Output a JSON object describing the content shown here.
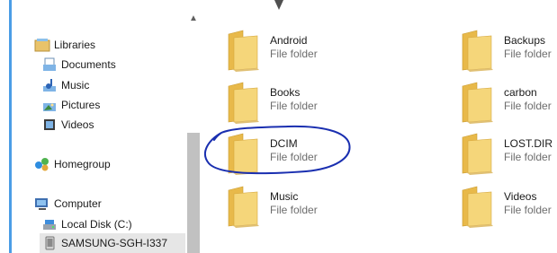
{
  "navigation": {
    "items": [
      {
        "label": "Libraries",
        "icon": "libraries-icon"
      },
      {
        "label": "Documents",
        "icon": "documents-icon"
      },
      {
        "label": "Music",
        "icon": "music-icon"
      },
      {
        "label": "Pictures",
        "icon": "pictures-icon"
      },
      {
        "label": "Videos",
        "icon": "videos-icon"
      },
      {
        "label": "Homegroup",
        "icon": "homegroup-icon"
      },
      {
        "label": "Computer",
        "icon": "computer-icon"
      },
      {
        "label": "Local Disk (C:)",
        "icon": "local-disk-icon"
      },
      {
        "label": "SAMSUNG-SGH-I337",
        "icon": "phone-icon",
        "selected": true
      }
    ]
  },
  "folders": [
    {
      "name": "Android",
      "type": "File folder"
    },
    {
      "name": "Backups",
      "type": "File folder"
    },
    {
      "name": "Books",
      "type": "File folder"
    },
    {
      "name": "carbon",
      "type": "File folder"
    },
    {
      "name": "DCIM",
      "type": "File folder",
      "annotated": true
    },
    {
      "name": "LOST.DIR",
      "type": "File folder"
    },
    {
      "name": "Music",
      "type": "File folder"
    },
    {
      "name": "Videos",
      "type": "File folder"
    }
  ],
  "colors": {
    "annotation_stroke": "#1a2fb0",
    "nav_edge": "#4b9de6",
    "folder_front": "#f5d67a",
    "folder_back": "#e8b94a"
  }
}
